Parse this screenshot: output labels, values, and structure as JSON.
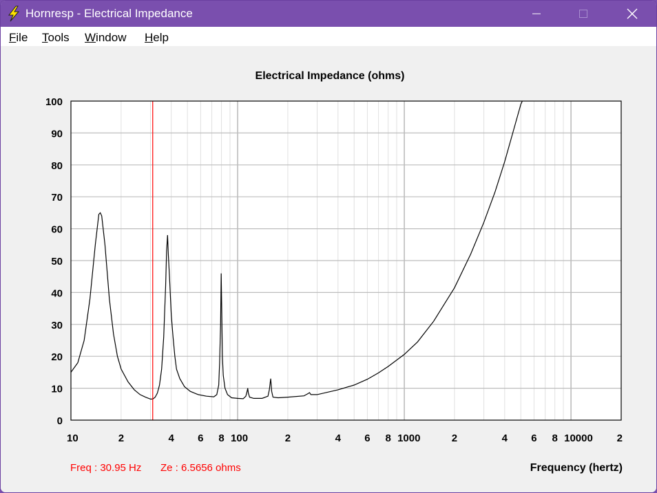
{
  "window": {
    "title": "Hornresp - Electrical Impedance",
    "icon": "lightning-bolt-icon",
    "controls": [
      "minimize-icon",
      "maximize-icon",
      "close-icon"
    ]
  },
  "menu": {
    "file": {
      "accel": "F",
      "rest": "ile"
    },
    "tools": {
      "accel": "T",
      "rest": "ools"
    },
    "window": {
      "accel": "W",
      "rest": "indow"
    },
    "help": {
      "accel": "H",
      "rest": "elp"
    }
  },
  "status": {
    "freq": "Freq : 30.95 Hz",
    "ze": "Ze : 6.5656 ohms",
    "color": "#ff0000"
  },
  "chart_data": {
    "type": "line",
    "title": "Electrical Impedance (ohms)",
    "xlabel": "Frequency (hertz)",
    "ylabel": "",
    "xscale": "log",
    "xlim": [
      10,
      20000
    ],
    "ylim": [
      0,
      100
    ],
    "grid": true,
    "x_tick_labels": [
      "10",
      "2",
      "4",
      "6",
      "8",
      "100",
      "2",
      "4",
      "6",
      "8",
      "1000",
      "2",
      "4",
      "6",
      "8",
      "10000",
      "2"
    ],
    "y_tick_labels": [
      "0",
      "10",
      "20",
      "30",
      "40",
      "50",
      "60",
      "70",
      "80",
      "90",
      "100"
    ],
    "cursor": {
      "x": 30.95,
      "color": "#ff0000"
    },
    "series": [
      {
        "color": "#000000",
        "points": [
          [
            10,
            15
          ],
          [
            11,
            18
          ],
          [
            12,
            25
          ],
          [
            13,
            38
          ],
          [
            14,
            55
          ],
          [
            14.7,
            64.5
          ],
          [
            15,
            65
          ],
          [
            15.3,
            64
          ],
          [
            16,
            55
          ],
          [
            17,
            38
          ],
          [
            18,
            27
          ],
          [
            19,
            20
          ],
          [
            20,
            16
          ],
          [
            22,
            12
          ],
          [
            24,
            9.5
          ],
          [
            26,
            8
          ],
          [
            28,
            7.2
          ],
          [
            30,
            6.6
          ],
          [
            31,
            6.6
          ],
          [
            32,
            7.2
          ],
          [
            33,
            8.5
          ],
          [
            34,
            11
          ],
          [
            35,
            16
          ],
          [
            36,
            26
          ],
          [
            37,
            42
          ],
          [
            37.5,
            53
          ],
          [
            38,
            58
          ],
          [
            38.4,
            52
          ],
          [
            39,
            45
          ],
          [
            40,
            33
          ],
          [
            41,
            26
          ],
          [
            42,
            20
          ],
          [
            43,
            16
          ],
          [
            45,
            13
          ],
          [
            48,
            10.5
          ],
          [
            52,
            9
          ],
          [
            58,
            8
          ],
          [
            65,
            7.5
          ],
          [
            72,
            7.3
          ],
          [
            75,
            8
          ],
          [
            77,
            11
          ],
          [
            78,
            18
          ],
          [
            79,
            30
          ],
          [
            79.7,
            46
          ],
          [
            80.2,
            36
          ],
          [
            81,
            20
          ],
          [
            82,
            14
          ],
          [
            84,
            10
          ],
          [
            87,
            8
          ],
          [
            92,
            7
          ],
          [
            100,
            6.8
          ],
          [
            108,
            6.7
          ],
          [
            112,
            7.5
          ],
          [
            114,
            9
          ],
          [
            115,
            10
          ],
          [
            116,
            8.5
          ],
          [
            118,
            7.2
          ],
          [
            125,
            6.8
          ],
          [
            140,
            6.8
          ],
          [
            152,
            7.5
          ],
          [
            155,
            9.5
          ],
          [
            157,
            12
          ],
          [
            158,
            13
          ],
          [
            160,
            9
          ],
          [
            163,
            7.2
          ],
          [
            175,
            7
          ],
          [
            200,
            7.2
          ],
          [
            250,
            7.6
          ],
          [
            262,
            8.2
          ],
          [
            270,
            8.6
          ],
          [
            275,
            8
          ],
          [
            300,
            8
          ],
          [
            400,
            9.5
          ],
          [
            500,
            11
          ],
          [
            600,
            12.8
          ],
          [
            700,
            14.8
          ],
          [
            800,
            16.8
          ],
          [
            1000,
            20.6
          ],
          [
            1200,
            24.5
          ],
          [
            1500,
            31
          ],
          [
            2000,
            41.5
          ],
          [
            2500,
            52
          ],
          [
            3000,
            62
          ],
          [
            3500,
            71.5
          ],
          [
            4000,
            81
          ],
          [
            4500,
            90.5
          ],
          [
            5000,
            99
          ],
          [
            5100,
            100
          ]
        ]
      }
    ]
  }
}
